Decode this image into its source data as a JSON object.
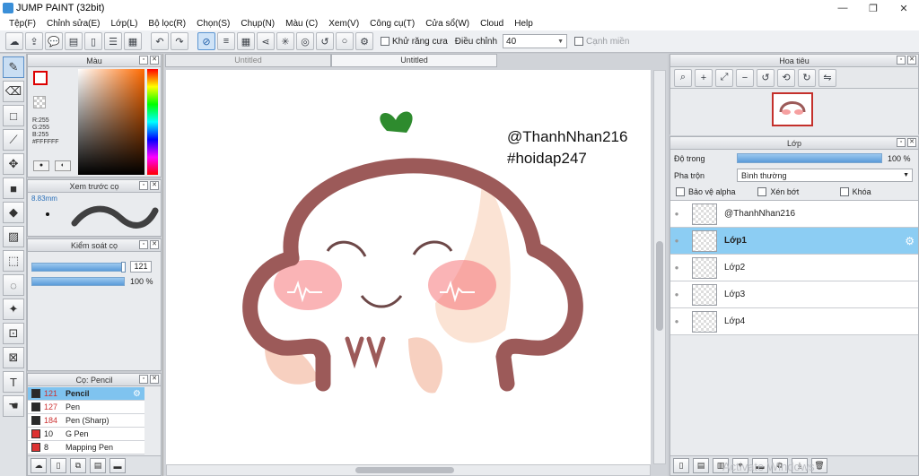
{
  "titlebar": {
    "title": "JUMP PAINT (32bit)",
    "minimize": "—",
    "maximize": "❐",
    "close": "✕"
  },
  "menu": [
    "Tệp(F)",
    "Chỉnh sửa(E)",
    "Lớp(L)",
    "Bộ lọc(R)",
    "Chọn(S)",
    "Chụp(N)",
    "Màu (C)",
    "Xem(V)",
    "Công cụ(T)",
    "Cửa sổ(W)",
    "Cloud",
    "Help"
  ],
  "toolbar": {
    "antialias_label": "Khử răng cưa",
    "adjust_label": "Điều chỉnh",
    "adjust_value": "40",
    "edge_label": "Cạnh miền"
  },
  "color_panel": {
    "title": "Màu",
    "r": "R:255",
    "g": "G:255",
    "b": "B:255",
    "hex": "#FFFFFF",
    "fg_color": "#ffffff",
    "bg_color": "#b03030"
  },
  "brush_preview": {
    "title": "Xem trước cọ",
    "size": "8.83mm"
  },
  "brush_control": {
    "title": "Kiểm soát cọ",
    "size_value": "121",
    "opacity_value": "100 %"
  },
  "brush_list": {
    "title": "Cọ: Pencil",
    "items": [
      {
        "size": "121",
        "name": "Pencil",
        "selected": true
      },
      {
        "size": "127",
        "name": "Pen",
        "selected": false
      },
      {
        "size": "184",
        "name": "Pen (Sharp)",
        "selected": false
      },
      {
        "size": "10",
        "name": "G Pen",
        "selected": false
      },
      {
        "size": "8",
        "name": "Mapping Pen",
        "selected": false
      }
    ]
  },
  "document": {
    "tabs": [
      "Untitled",
      "Untitled"
    ],
    "credit_line1": "@ThanhNhan216",
    "credit_line2": "#hoidap247"
  },
  "navigator": {
    "title": "Hoa tiêu"
  },
  "layers_panel": {
    "title": "Lớp",
    "opacity_label": "Độ trong",
    "opacity_value": "100 %",
    "blend_label": "Pha trộn",
    "blend_value": "Bình thường",
    "protect_alpha": "Bảo vệ alpha",
    "clipping": "Xén bớt",
    "lock": "Khóa",
    "layers": [
      {
        "name": "@ThanhNhan216",
        "selected": false
      },
      {
        "name": "Lớp1",
        "selected": true
      },
      {
        "name": "Lớp2",
        "selected": false
      },
      {
        "name": "Lớp3",
        "selected": false
      },
      {
        "name": "Lớp4",
        "selected": false
      }
    ]
  },
  "watermark": "Activate Windows"
}
